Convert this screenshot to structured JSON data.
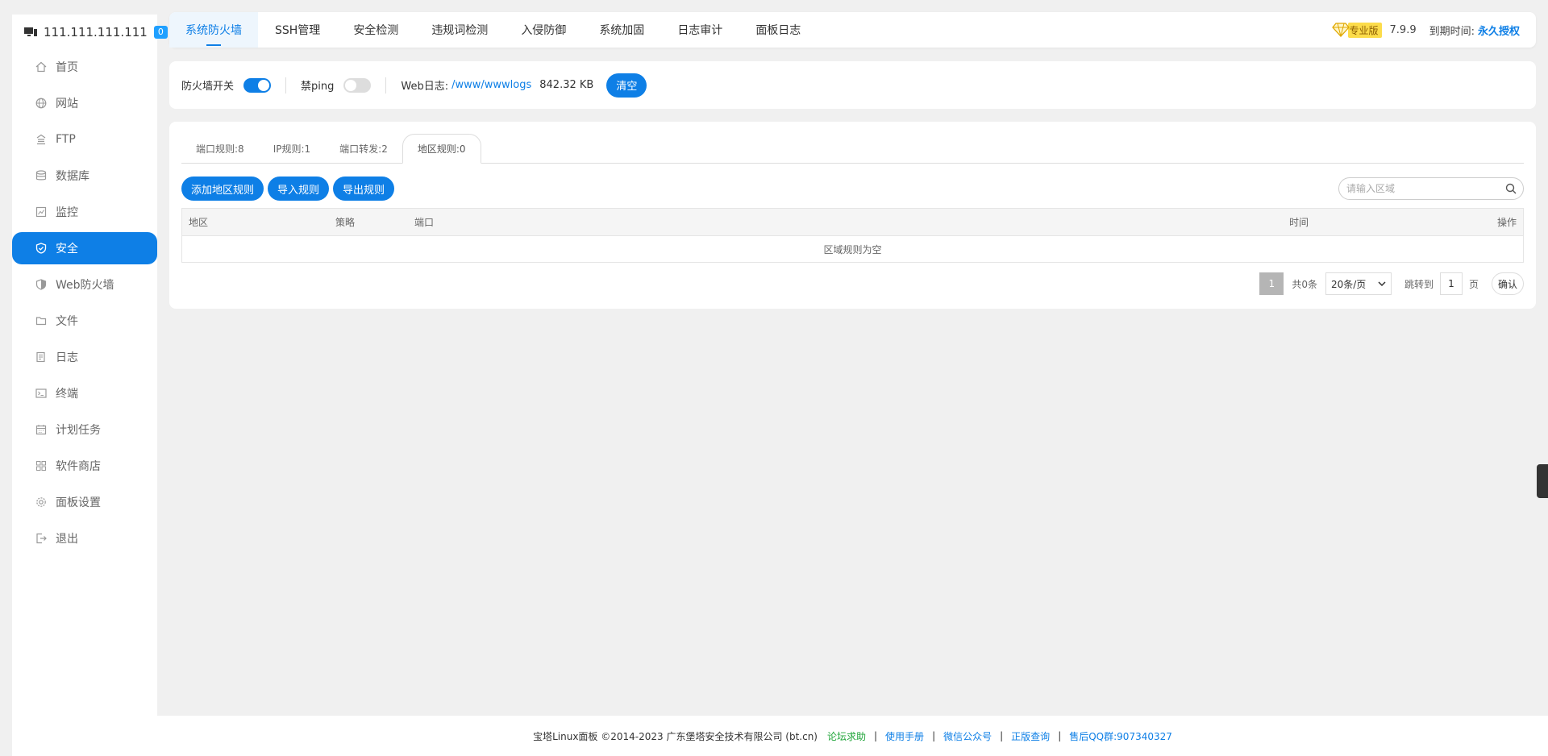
{
  "server": {
    "ip": "111.111.111.111",
    "badge": "0"
  },
  "sidebar": {
    "items": [
      {
        "label": "首页",
        "icon": "home-icon"
      },
      {
        "label": "网站",
        "icon": "globe-icon"
      },
      {
        "label": "FTP",
        "icon": "ftp-icon"
      },
      {
        "label": "数据库",
        "icon": "database-icon"
      },
      {
        "label": "监控",
        "icon": "monitor-icon"
      },
      {
        "label": "安全",
        "icon": "shield-check-icon",
        "active": true
      },
      {
        "label": "Web防火墙",
        "icon": "shield-icon"
      },
      {
        "label": "文件",
        "icon": "folder-icon"
      },
      {
        "label": "日志",
        "icon": "log-icon"
      },
      {
        "label": "终端",
        "icon": "terminal-icon"
      },
      {
        "label": "计划任务",
        "icon": "calendar-icon"
      },
      {
        "label": "软件商店",
        "icon": "apps-icon"
      },
      {
        "label": "面板设置",
        "icon": "gear-icon"
      },
      {
        "label": "退出",
        "icon": "logout-icon"
      }
    ]
  },
  "topbar": {
    "tabs": [
      "系统防火墙",
      "SSH管理",
      "安全检测",
      "违规词检测",
      "入侵防御",
      "系统加固",
      "日志审计",
      "面板日志"
    ],
    "pro_label": "专业版",
    "version": "7.9.9",
    "expire_label": "到期时间:",
    "expire_value": "永久授权"
  },
  "controls": {
    "firewall_label": "防火墙开关",
    "ping_label": "禁ping",
    "weblog_label": "Web日志:",
    "weblog_path": "/www/wwwlogs",
    "weblog_size": "842.32 KB",
    "clear_button": "清空"
  },
  "subtabs": [
    "端口规则:8",
    "IP规则:1",
    "端口转发:2",
    "地区规则:0"
  ],
  "tools": {
    "add_button": "添加地区规则",
    "import_button": "导入规则",
    "export_button": "导出规则",
    "search_placeholder": "请输入区域"
  },
  "table": {
    "columns": [
      "地区",
      "策略",
      "端口",
      "时间",
      "操作"
    ],
    "empty_text": "区域规则为空"
  },
  "pager": {
    "current": "1",
    "total": "共0条",
    "per_page": "20条/页",
    "jump_label": "跳转到",
    "jump_value": "1",
    "page_label": "页",
    "confirm": "确认"
  },
  "footer": {
    "copyright": "宝塔Linux面板 ©2014-2023 广东堡塔安全技术有限公司 (bt.cn)",
    "forum": "论坛求助",
    "manual": "使用手册",
    "wechat": "微信公众号",
    "genuine": "正版查询",
    "qq": "售后QQ群:907340327"
  },
  "colors": {
    "accent": "#0e7fe6",
    "green": "#20a53a",
    "pro": "#fcdc4b"
  }
}
